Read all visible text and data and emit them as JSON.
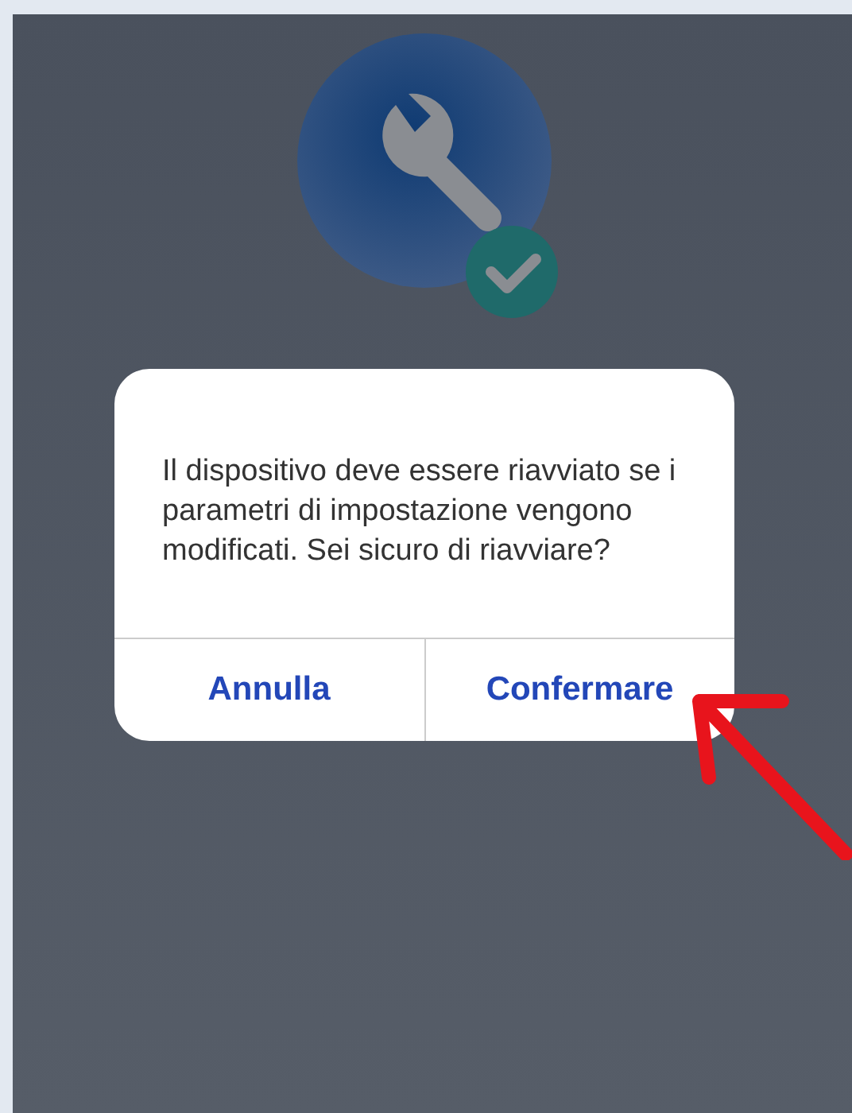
{
  "dialog": {
    "message": "Il dispositivo deve essere riavviato se i parametri di impostazione vengono modificati. Sei sicuro di riavviare?",
    "buttons": [
      {
        "label": "Annulla"
      },
      {
        "label": "Confermare"
      }
    ]
  }
}
